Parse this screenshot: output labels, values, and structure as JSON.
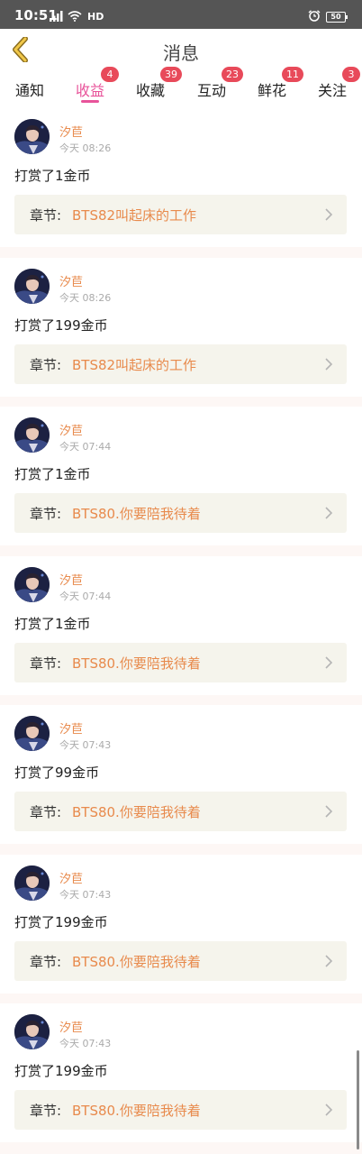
{
  "status_bar": {
    "time": "10:51",
    "network": "HD",
    "battery": "50"
  },
  "header": {
    "title": "消息"
  },
  "tabs": [
    {
      "label": "通知",
      "badge": ""
    },
    {
      "label": "收益",
      "badge": "4",
      "active": true
    },
    {
      "label": "收藏",
      "badge": "39"
    },
    {
      "label": "互动",
      "badge": "23"
    },
    {
      "label": "鲜花",
      "badge": "11"
    },
    {
      "label": "关注",
      "badge": "3"
    }
  ],
  "messages": [
    {
      "sender": "汐苣",
      "time": "今天 08:26",
      "text": "打赏了1金币",
      "chapter_prefix": "章节:",
      "chapter": "BTS82叫起床的工作"
    },
    {
      "sender": "汐苣",
      "time": "今天 08:26",
      "text": "打赏了199金币",
      "chapter_prefix": "章节:",
      "chapter": "BTS82叫起床的工作"
    },
    {
      "sender": "汐苣",
      "time": "今天 07:44",
      "text": "打赏了1金币",
      "chapter_prefix": "章节:",
      "chapter": "BTS80.你要陪我待着"
    },
    {
      "sender": "汐苣",
      "time": "今天 07:44",
      "text": "打赏了1金币",
      "chapter_prefix": "章节:",
      "chapter": "BTS80.你要陪我待着"
    },
    {
      "sender": "汐苣",
      "time": "今天 07:43",
      "text": "打赏了99金币",
      "chapter_prefix": "章节:",
      "chapter": "BTS80.你要陪我待着"
    },
    {
      "sender": "汐苣",
      "time": "今天 07:43",
      "text": "打赏了199金币",
      "chapter_prefix": "章节:",
      "chapter": "BTS80.你要陪我待着"
    },
    {
      "sender": "汐苣",
      "time": "今天 07:43",
      "text": "打赏了199金币",
      "chapter_prefix": "章节:",
      "chapter": "BTS80.你要陪我待着"
    }
  ],
  "colors": {
    "accent": "#e8539a",
    "badge": "#e84a5a",
    "chapter_link": "#e88a4c",
    "status_bar": "#555555"
  },
  "icons": {
    "back": "chevron-left-icon",
    "chapter_arrow": "chevron-right-icon"
  }
}
